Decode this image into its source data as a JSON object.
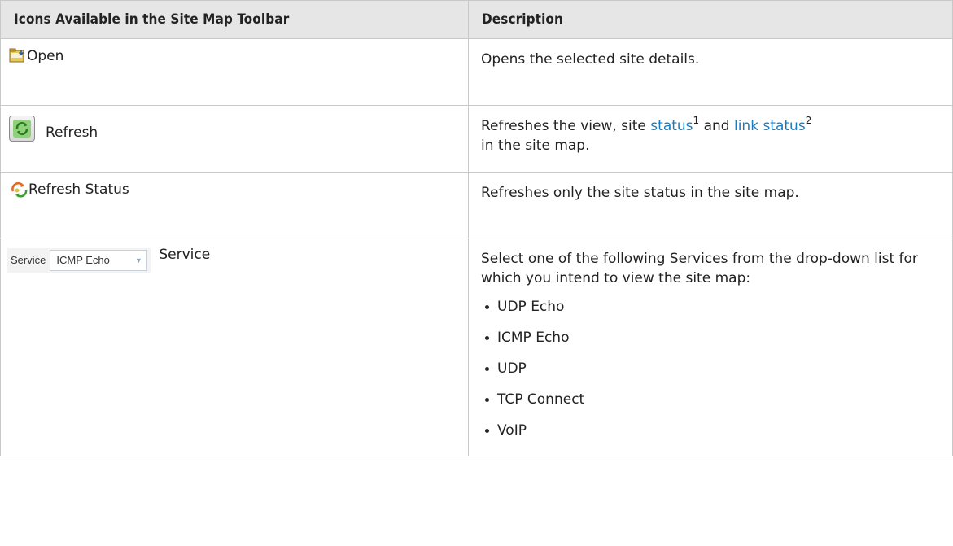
{
  "table": {
    "header": {
      "col1": "Icons Available in the Site Map Toolbar",
      "col2": "Description"
    },
    "rows": {
      "open": {
        "icon": "folder-open-icon",
        "label": "Open",
        "description": "Opens the selected site details."
      },
      "refresh": {
        "icon": "refresh-icon",
        "label": "Refresh",
        "desc_part1": "Refreshes the view, site ",
        "link1": "status",
        "sup1": "1",
        "desc_part2": " and ",
        "link2": "link status",
        "sup2": "2",
        "desc_part3": "in the site map."
      },
      "refresh_status": {
        "icon": "refresh-status-icon",
        "label": "Refresh Status",
        "description": "Refreshes only the site status in the site map."
      },
      "service": {
        "widget_label": "Service",
        "widget_value": "ICMP Echo",
        "label": "Service",
        "description": "Select one of the following Services from the drop-down list for which you intend to view the site map:",
        "options": [
          "UDP Echo",
          "ICMP Echo",
          "UDP",
          "TCP Connect",
          "VoIP"
        ]
      }
    }
  },
  "colors": {
    "header_bg": "#e6e6e6",
    "border": "#c8c8c8",
    "link": "#1a7bbf"
  }
}
